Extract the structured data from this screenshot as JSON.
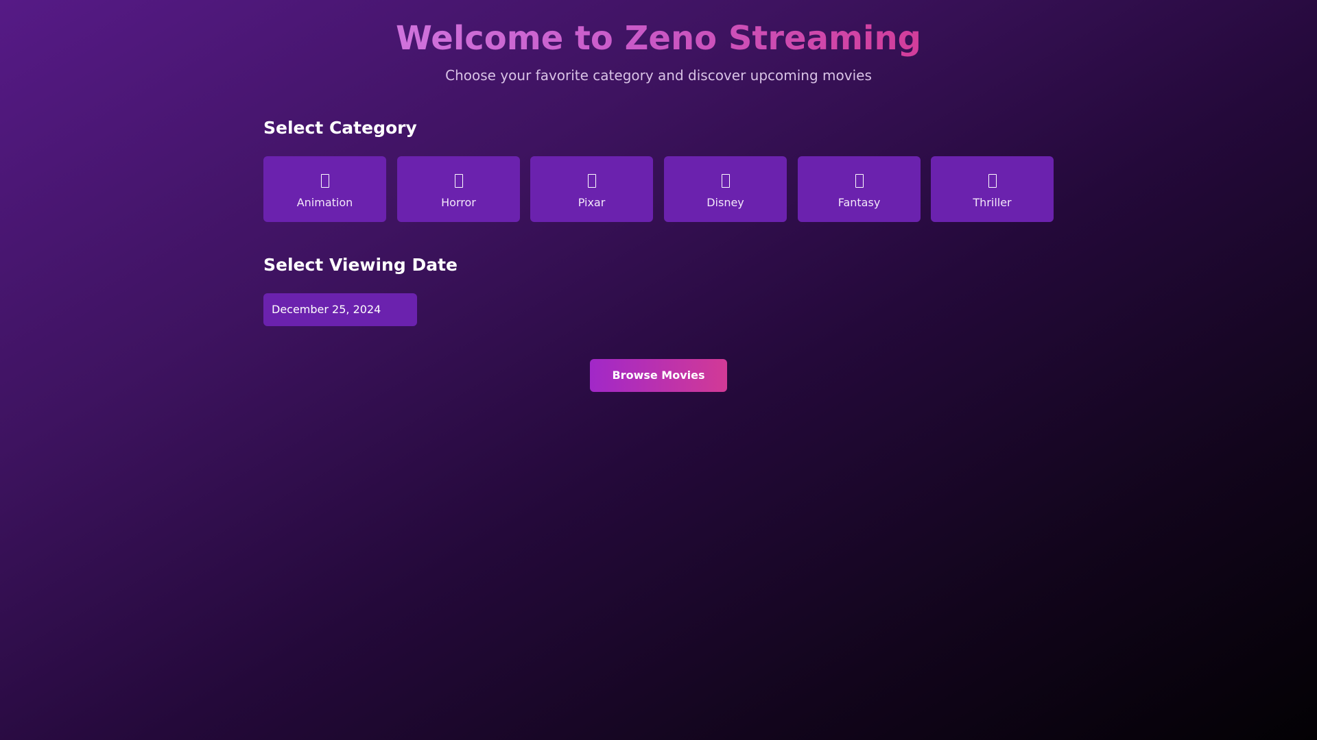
{
  "header": {
    "title": "Welcome to Zeno Streaming",
    "subtitle": "Choose your favorite category and discover upcoming movies"
  },
  "category_section": {
    "heading": "Select Category",
    "categories": [
      {
        "label": "Animation",
        "icon": "missing-glyph-icon"
      },
      {
        "label": "Horror",
        "icon": "missing-glyph-icon"
      },
      {
        "label": "Pixar",
        "icon": "missing-glyph-icon"
      },
      {
        "label": "Disney",
        "icon": "missing-glyph-icon"
      },
      {
        "label": "Fantasy",
        "icon": "missing-glyph-icon"
      },
      {
        "label": "Thriller",
        "icon": "missing-glyph-icon"
      }
    ]
  },
  "date_section": {
    "heading": "Select Viewing Date",
    "selected_date": "December 25, 2024"
  },
  "actions": {
    "browse_label": "Browse Movies"
  },
  "colors": {
    "card_background": "#6b22ae",
    "accent_gradient_start": "#a128c8",
    "accent_gradient_end": "#d23a96",
    "title_gradient_start": "#cf73dc",
    "title_gradient_end": "#d23d9a"
  }
}
